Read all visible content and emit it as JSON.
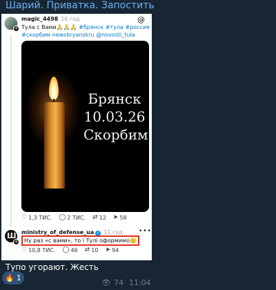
{
  "channel": {
    "name": "Шарий. Приватка. Запостить"
  },
  "post1": {
    "username": "magic_4498",
    "time": "16 год",
    "text_plain": "Тула с Вами🙏🙏🙏 ",
    "text_tags": "#брянск #тула #россия #скорбим newsbryanskru @novosti_tula",
    "image_lines": [
      "Брянск",
      "10.03.26",
      "Скорбим"
    ],
    "stats": {
      "likes": "1,3 ТИС.",
      "comments": "2 ТИС.",
      "reposts": "12",
      "shares": "58"
    }
  },
  "post2": {
    "username": "ministry_of_defense_ua",
    "time": "11 год",
    "text": "Ну раз «с вами», то і Тулі оформимо🫡",
    "stats": {
      "likes": "10,8 ТИС.",
      "comments": "46",
      "reposts": "10",
      "shares": "94"
    }
  },
  "message": {
    "caption": "Тупо угорают. Жесть",
    "reaction_count": "1",
    "views": "74",
    "time": "11:04"
  },
  "icons": {
    "threads": "threads-logo-icon",
    "like": "heart-icon",
    "comment": "comment-icon",
    "repost": "repost-icon",
    "share": "share-icon",
    "views": "eye-icon",
    "reaction": "fire-icon"
  },
  "colors": {
    "background": "#0e1621",
    "bubble": "#182533",
    "channel_name": "#6ab3f3",
    "highlight_border": "#e0301e",
    "meta": "#6d7f8f"
  }
}
